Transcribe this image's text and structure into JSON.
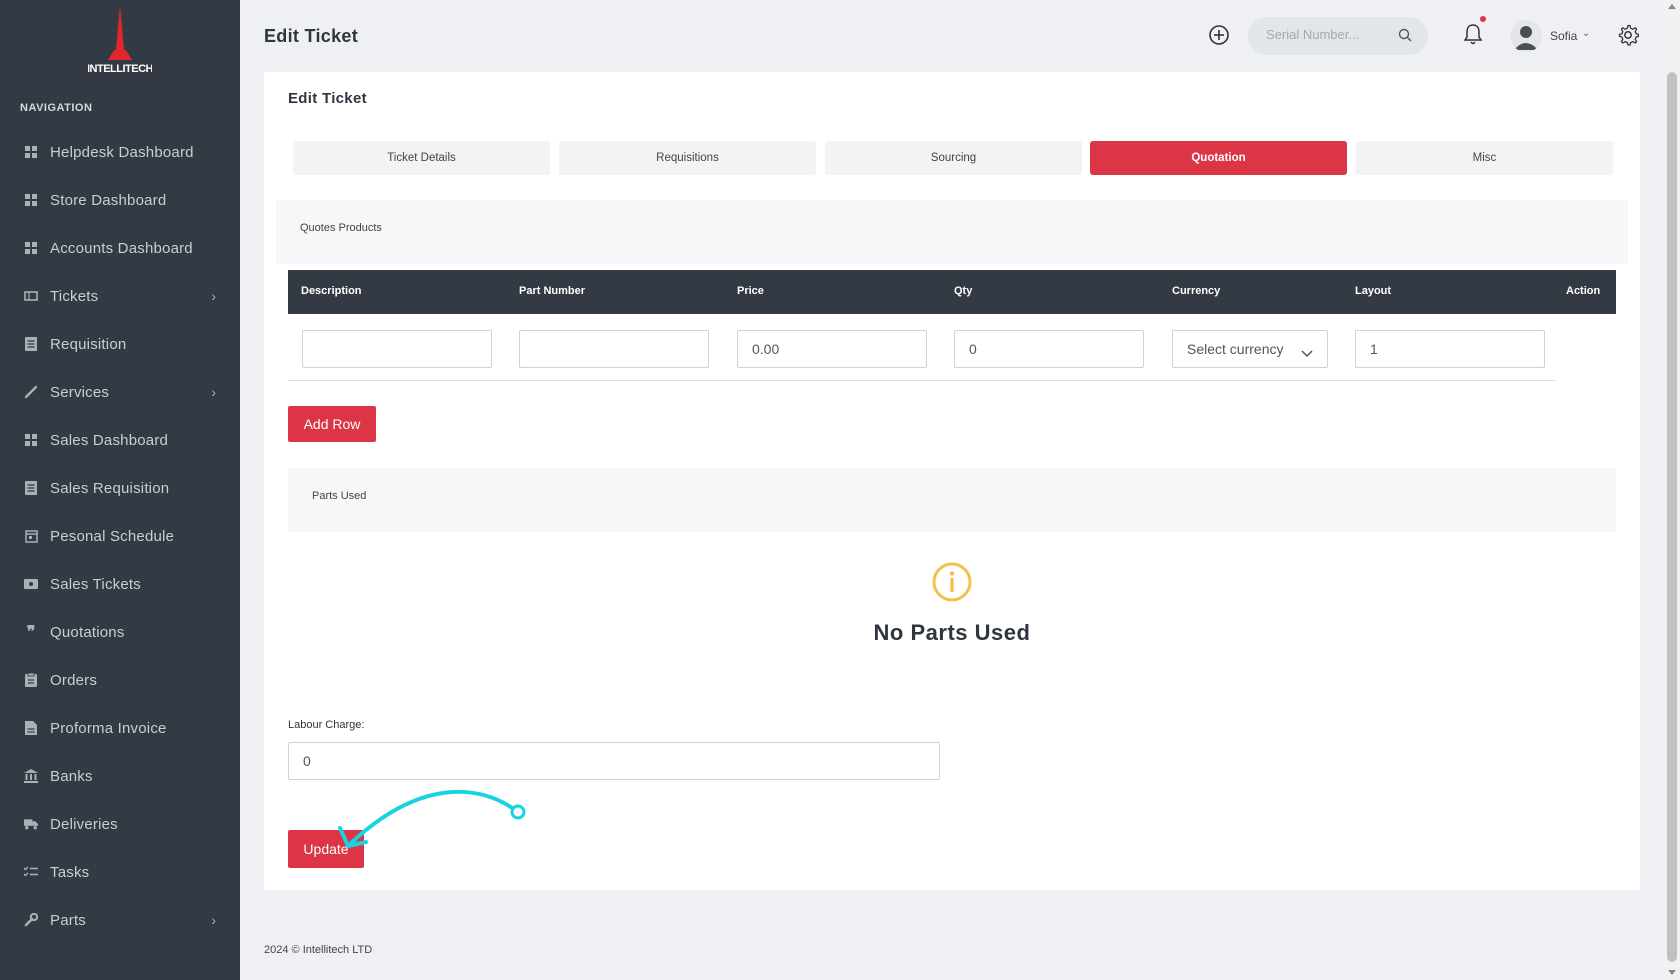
{
  "brand": {
    "name": "INTELLITECH"
  },
  "sidebar": {
    "heading": "NAVIGATION",
    "items": [
      {
        "label": "Helpdesk Dashboard",
        "icon": "dashboard-icon"
      },
      {
        "label": "Store Dashboard",
        "icon": "dashboard-icon"
      },
      {
        "label": "Accounts Dashboard",
        "icon": "dashboard-icon"
      },
      {
        "label": "Tickets",
        "icon": "ticket-icon",
        "chevron": "›"
      },
      {
        "label": "Requisition",
        "icon": "document-icon"
      },
      {
        "label": "Services",
        "icon": "pen-icon",
        "chevron": "›"
      },
      {
        "label": "Sales Dashboard",
        "icon": "dashboard-icon"
      },
      {
        "label": "Sales Requisition",
        "icon": "document-icon"
      },
      {
        "label": "Pesonal Schedule",
        "icon": "calendar-icon"
      },
      {
        "label": "Sales Tickets",
        "icon": "ticket-icon"
      },
      {
        "label": "Quotations",
        "icon": "quote-icon"
      },
      {
        "label": "Orders",
        "icon": "clipboard-icon"
      },
      {
        "label": "Proforma Invoice",
        "icon": "file-icon"
      },
      {
        "label": "Banks",
        "icon": "bank-icon"
      },
      {
        "label": "Deliveries",
        "icon": "truck-icon"
      },
      {
        "label": "Tasks",
        "icon": "checklist-icon"
      },
      {
        "label": "Parts",
        "icon": "wrench-icon",
        "chevron": "›"
      }
    ]
  },
  "header": {
    "title": "Edit Ticket",
    "search_placeholder": "Serial Number...",
    "user_name": "Sofia",
    "user_chevron": "⌄"
  },
  "card": {
    "title": "Edit Ticket",
    "tabs": [
      {
        "label": "Ticket Details",
        "active": false
      },
      {
        "label": "Requisitions",
        "active": false
      },
      {
        "label": "Sourcing",
        "active": false
      },
      {
        "label": "Quotation",
        "active": true
      },
      {
        "label": "Misc",
        "active": false
      }
    ],
    "quotes_heading": "Quotes Products",
    "table_headers": [
      "Description",
      "Part Number",
      "Price",
      "Qty",
      "Currency",
      "Layout",
      "Action"
    ],
    "row": {
      "description": "",
      "part_number": "",
      "price": "0.00",
      "qty": "0",
      "currency": "Select currency",
      "layout": "1"
    },
    "add_row_label": "Add Row",
    "parts_heading": "Parts Used",
    "empty_message": "No Parts Used",
    "labour_label": "Labour Charge:",
    "labour_value": "0",
    "update_label": "Update"
  },
  "footer": {
    "text": "2024 © Intellitech LTD"
  },
  "colors": {
    "accent": "#dc3545",
    "sidebar": "#343a44",
    "annotation": "#19d3dd",
    "warning": "#f5c04a"
  }
}
